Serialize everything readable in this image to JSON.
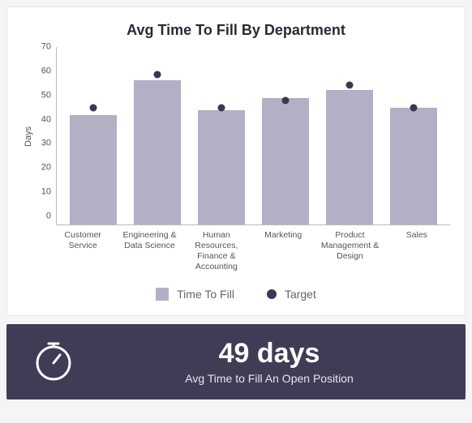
{
  "title": "Avg Time To Fill By Department",
  "ylabel": "Days",
  "yticks": [
    "70",
    "60",
    "50",
    "40",
    "30",
    "20",
    "10",
    "0"
  ],
  "legend": {
    "bar": "Time To Fill",
    "dot": "Target"
  },
  "summary": {
    "headline": "49 days",
    "subtitle": "Avg Time to Fill An Open Position"
  },
  "chart_data": {
    "type": "bar",
    "title": "Avg Time To Fill By Department",
    "ylabel": "Days",
    "xlabel": "",
    "ylim": [
      0,
      70
    ],
    "grid": false,
    "legend_position": "bottom",
    "categories": [
      "Customer Service",
      "Engineering & Data Science",
      "Human Resources, Finance & Accounting",
      "Marketing",
      "Product Management & Design",
      "Sales"
    ],
    "series": [
      {
        "name": "Time To Fill",
        "kind": "bar",
        "color": "#b2b0c4",
        "values": [
          43,
          57,
          45,
          50,
          53,
          46
        ]
      },
      {
        "name": "Target",
        "kind": "point",
        "color": "#3b3651",
        "values": [
          46,
          59,
          46,
          49,
          55,
          46
        ]
      }
    ]
  }
}
